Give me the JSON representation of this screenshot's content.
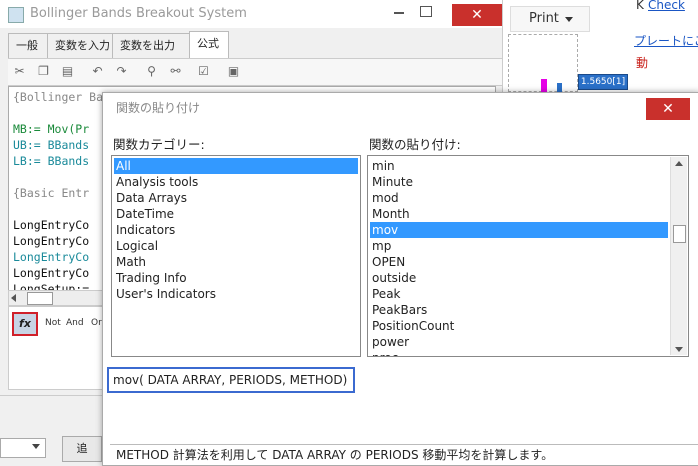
{
  "app": {
    "title": "Bollinger Bands Breakout System",
    "tabs": [
      {
        "label": "一般"
      },
      {
        "label": "変数を入力"
      },
      {
        "label": "変数を出力"
      },
      {
        "label": "公式"
      }
    ],
    "editor_lines": [
      "{Bollinger Bands}",
      "",
      "MB:= Mov(Pr",
      "UB:= BBands",
      "LB:= BBands",
      "",
      "{Basic Entr",
      "",
      "LongEntryCo",
      "LongEntryCo",
      "LongEntryCo",
      "LongEntryCo",
      "LongSetup:="
    ],
    "operators": [
      "Not",
      "And",
      "Or"
    ],
    "fx_label": "fx",
    "bottom_button": "追"
  },
  "chart": {
    "print_label": "Print",
    "price_tag": "1.5650[1]",
    "colors": {
      "candle": "#e600e6",
      "price_tag": "#2a70c8"
    }
  },
  "right_pane": {
    "link_text": "Check",
    "prefix": "K",
    "line2": "プレートにこ",
    "line3": "動"
  },
  "dialog": {
    "title": "関数の貼り付け",
    "category_label": "関数カテゴリー:",
    "function_label": "関数の貼り付け:",
    "categories": [
      "All",
      "Analysis tools",
      "Data Arrays",
      "DateTime",
      "Indicators",
      "Logical",
      "Math",
      "Trading Info",
      "User's Indicators"
    ],
    "selected_category": "All",
    "functions": [
      "min",
      "Minute",
      "mod",
      "Month",
      "mov",
      "mp",
      "OPEN",
      "outside",
      "Peak",
      "PeakBars",
      "PositionCount",
      "power",
      "proc"
    ],
    "selected_function": "mov",
    "syntax": "mov( DATA ARRAY, PERIODS, METHOD)",
    "description": "METHOD 計算法を利用して DATA ARRAY の PERIODS 移動平均を計算します。"
  }
}
